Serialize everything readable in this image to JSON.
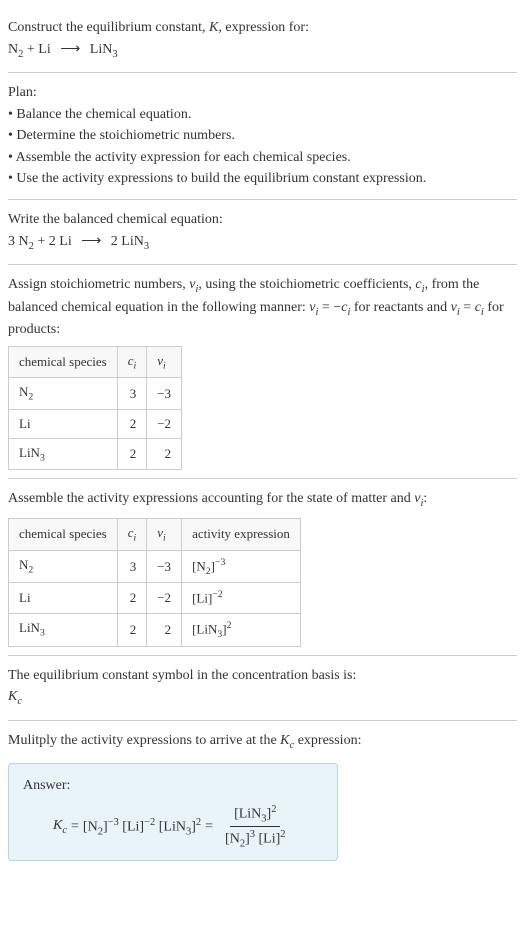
{
  "header": {
    "title": "Construct the equilibrium constant, K, expression for:",
    "equation": "N₂ + Li ⟶ LiN₃"
  },
  "plan": {
    "title": "Plan:",
    "items": [
      "• Balance the chemical equation.",
      "• Determine the stoichiometric numbers.",
      "• Assemble the activity expression for each chemical species.",
      "• Use the activity expressions to build the equilibrium constant expression."
    ]
  },
  "balanced": {
    "title": "Write the balanced chemical equation:",
    "equation": "3 N₂ + 2 Li ⟶ 2 LiN₃"
  },
  "stoich": {
    "intro1": "Assign stoichiometric numbers, νᵢ, using the stoichiometric coefficients, cᵢ, from",
    "intro2": "the balanced chemical equation in the following manner: νᵢ = −cᵢ for reactants",
    "intro3": "and νᵢ = cᵢ for products:",
    "headers": [
      "chemical species",
      "cᵢ",
      "νᵢ"
    ],
    "rows": [
      {
        "species": "N₂",
        "c": "3",
        "v": "−3"
      },
      {
        "species": "Li",
        "c": "2",
        "v": "−2"
      },
      {
        "species": "LiN₃",
        "c": "2",
        "v": "2"
      }
    ]
  },
  "activity": {
    "intro": "Assemble the activity expressions accounting for the state of matter and νᵢ:",
    "headers": [
      "chemical species",
      "cᵢ",
      "νᵢ",
      "activity expression"
    ],
    "rows": [
      {
        "species": "N₂",
        "c": "3",
        "v": "−3",
        "expr": "[N₂]⁻³"
      },
      {
        "species": "Li",
        "c": "2",
        "v": "−2",
        "expr": "[Li]⁻²"
      },
      {
        "species": "LiN₃",
        "c": "2",
        "v": "2",
        "expr": "[LiN₃]²"
      }
    ]
  },
  "symbol": {
    "title": "The equilibrium constant symbol in the concentration basis is:",
    "value": "K_c"
  },
  "final": {
    "title": "Mulitply the activity expressions to arrive at the K_c expression:",
    "answer_label": "Answer:",
    "kc": "K_c",
    "eq": "=",
    "lhs_parts": [
      "[N₂]⁻³",
      "[Li]⁻²",
      "[LiN₃]²"
    ],
    "numerator": "[LiN₃]²",
    "denominator": "[N₂]³ [Li]²"
  }
}
